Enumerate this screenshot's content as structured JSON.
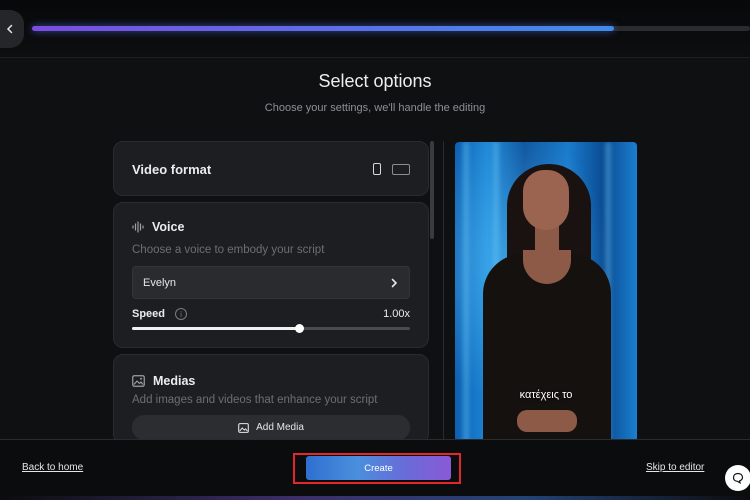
{
  "header": {
    "progress_fraction": 0.81
  },
  "page": {
    "title": "Select options",
    "subtitle": "Choose your settings, we'll handle the editing"
  },
  "video_format": {
    "label": "Video format",
    "selected": "portrait"
  },
  "voice": {
    "title": "Voice",
    "description": "Choose a voice to embody your script",
    "selected_voice": "Evelyn",
    "speed_label": "Speed",
    "speed_value": "1.00x",
    "speed_slider_fraction": 0.6
  },
  "medias": {
    "title": "Medias",
    "description": "Add images and videos that enhance your script",
    "add_button_label": "Add Media"
  },
  "preview": {
    "caption": "κατέχεις το"
  },
  "footer": {
    "back_label": "Back to home",
    "create_label": "Create",
    "skip_label": "Skip to editor"
  },
  "colors": {
    "accent_start": "#7a4de0",
    "accent_end": "#3f8de8",
    "highlight_border": "#e3262c"
  }
}
